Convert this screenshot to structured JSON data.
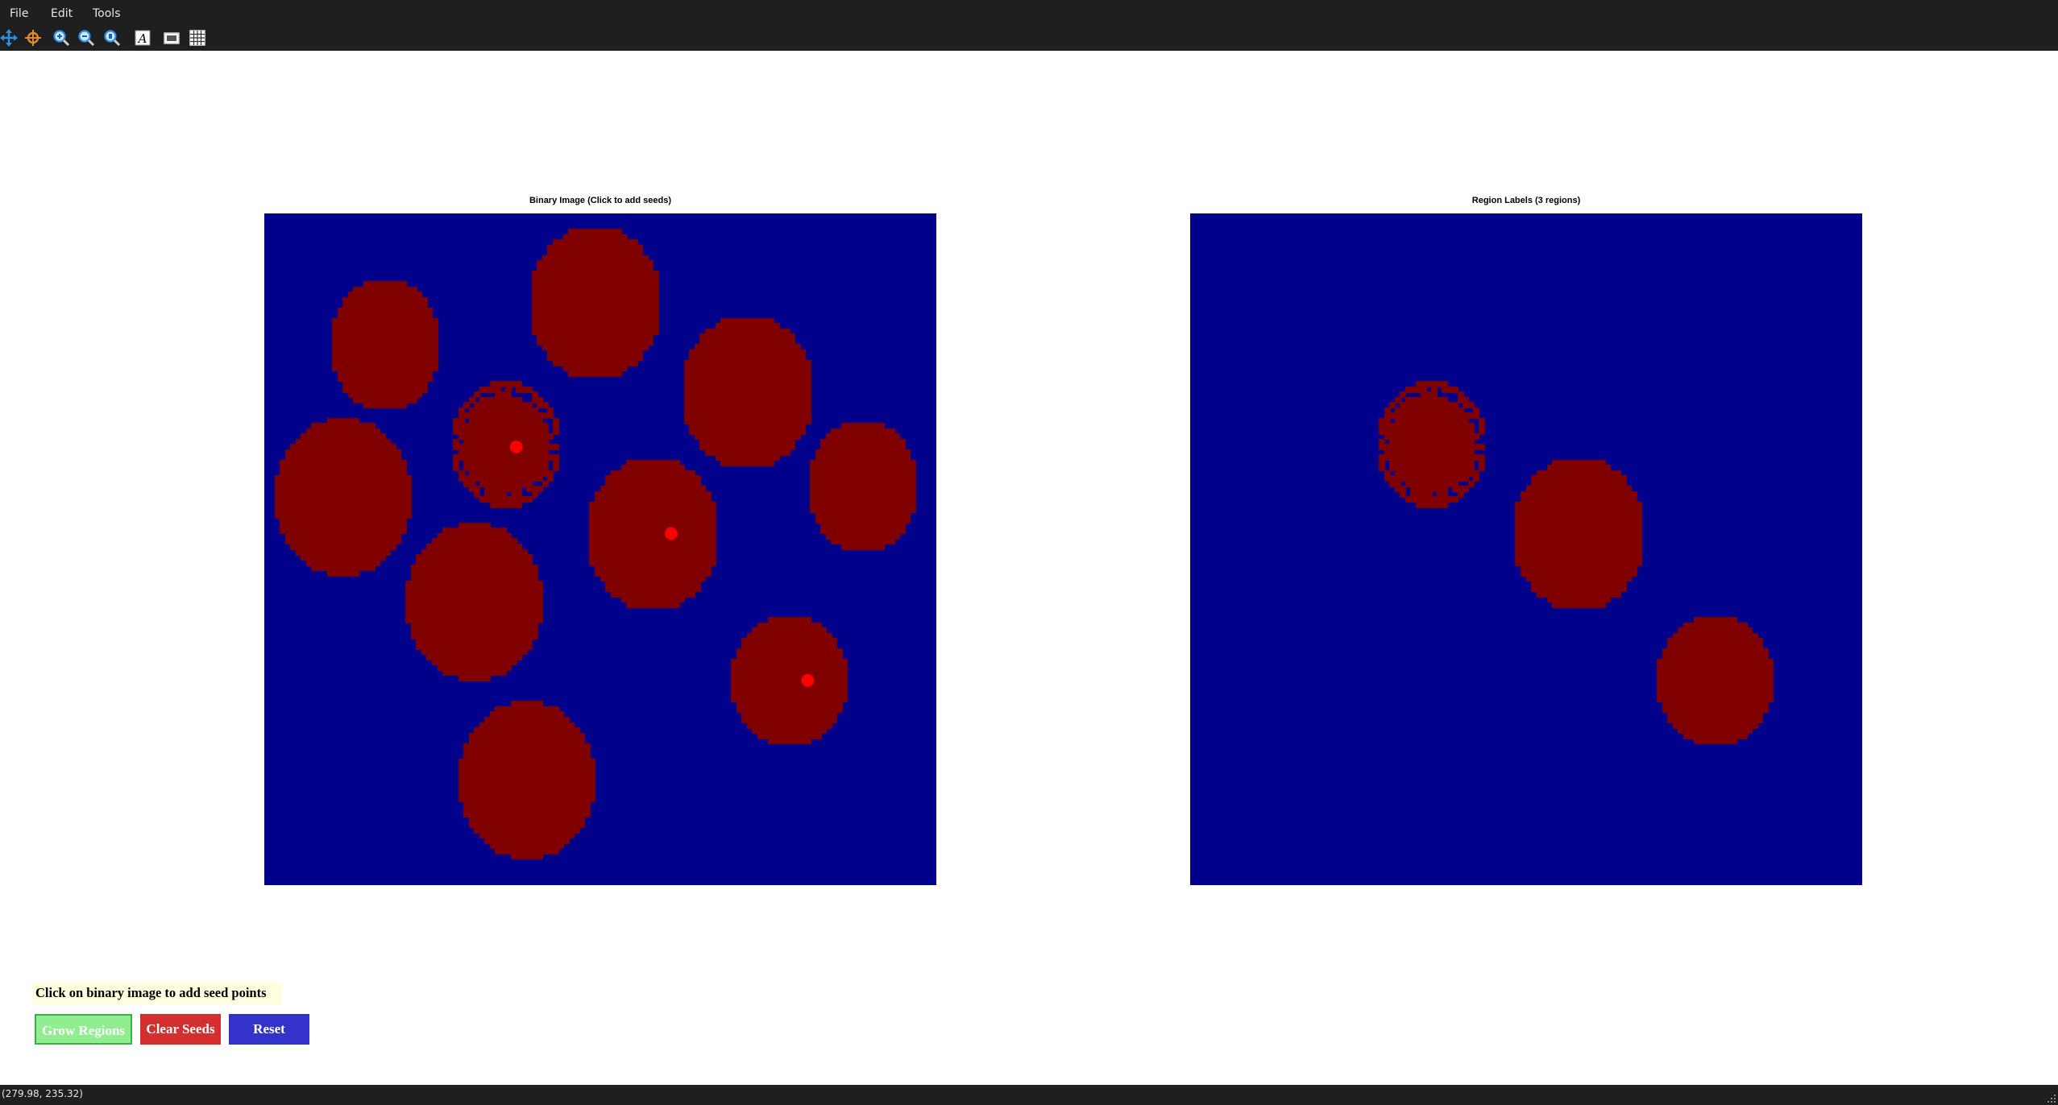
{
  "menu": {
    "file": "File",
    "edit": "Edit",
    "tools": "Tools"
  },
  "toolbar": {
    "pan": "pan-icon",
    "rotate": "rotate-icon",
    "zoom_in": "zoom-in-icon",
    "zoom_out": "zoom-out-icon",
    "zoom_reset": "zoom-reset-icon",
    "text": "text-icon",
    "screenshot": "screenshot-icon",
    "grid": "grid-icon"
  },
  "colors": {
    "menubar": "#1f1f1f",
    "background": "#00008b",
    "region": "#800000",
    "seed": "#ff0000",
    "grow_button": "#90ee90",
    "clear_button": "#d32f2f",
    "reset_button": "#3333cc",
    "hint_background": "#ffffe0"
  },
  "left_plot": {
    "title": "Binary Image (Click to add seeds)"
  },
  "right_plot": {
    "title": "Region Labels (3 regions)"
  },
  "hint": "Click on binary image to add seed points",
  "buttons": {
    "grow": "Grow Regions",
    "clear": "Clear Seeds",
    "reset": "Reset"
  },
  "status": {
    "coords": "(279.98, 235.32)"
  }
}
